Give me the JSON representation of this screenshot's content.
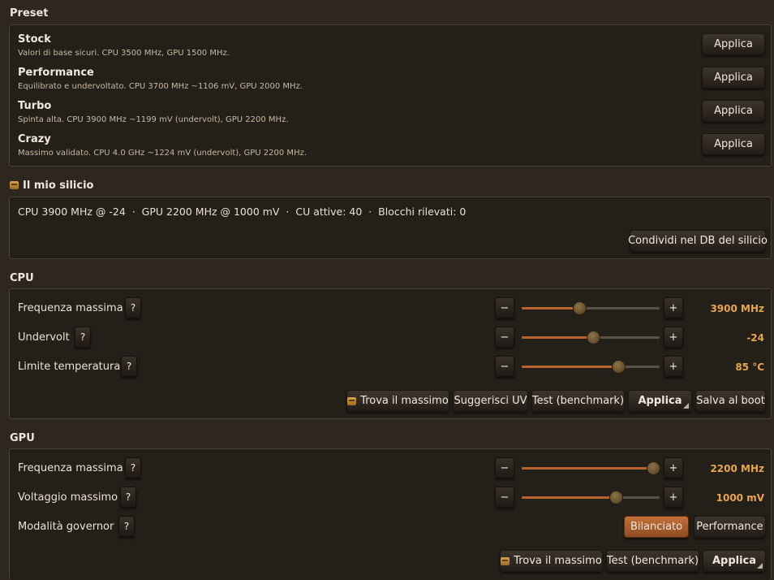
{
  "preset": {
    "title": "Preset",
    "items": [
      {
        "name": "Stock",
        "desc": "Valori di base sicuri. CPU 3500 MHz, GPU 1500 MHz.",
        "button": "Applica"
      },
      {
        "name": "Performance",
        "desc": "Equilibrato e undervoltato. CPU 3700 MHz ~1106 mV, GPU 2000 MHz.",
        "button": "Applica"
      },
      {
        "name": "Turbo",
        "desc": "Spinta alta. CPU 3900 MHz ~1199 mV (undervolt), GPU 2200 MHz.",
        "button": "Applica"
      },
      {
        "name": "Crazy",
        "desc": "Massimo validato. CPU 4.0 GHz ~1224 mV (undervolt), GPU 2200 MHz.",
        "button": "Applica"
      }
    ]
  },
  "silicon": {
    "title": "Il mio silicio",
    "summary": "CPU 3900 MHz @ -24  ·  GPU 2200 MHz @ 1000 mV  ·  CU attive: 40  ·  Blocchi rilevati: 0",
    "share_button": "Condividi nel DB del silicio"
  },
  "cpu": {
    "title": "CPU",
    "rows": [
      {
        "label": "Frequenza massima",
        "help": "?",
        "value": "3900 MHz",
        "level": 0.42
      },
      {
        "label": "Undervolt",
        "help": "?",
        "value": "-24",
        "level": 0.52
      },
      {
        "label": "Limite temperatura",
        "help": "?",
        "value": "85 °C",
        "level": 0.7
      }
    ],
    "minus": "−",
    "plus": "+",
    "actions": {
      "find_max": "Trova il massimo",
      "suggest_uv": "Suggerisci UV",
      "benchmark": "Test (benchmark)",
      "apply": "Applica",
      "save_boot": "Salva al boot"
    }
  },
  "gpu": {
    "title": "GPU",
    "rows": [
      {
        "label": "Frequenza massima",
        "help": "?",
        "value": "2200 MHz",
        "level": 0.95
      },
      {
        "label": "Voltaggio massimo",
        "help": "?",
        "value": "1000 mV",
        "level": 0.68
      }
    ],
    "governor": {
      "label": "Modalità governor",
      "help": "?",
      "options": [
        "Bilanciato",
        "Performance"
      ],
      "selected": "Bilanciato"
    },
    "minus": "−",
    "plus": "+",
    "actions": {
      "find_max": "Trova il massimo",
      "benchmark": "Test (benchmark)",
      "apply": "Applica"
    }
  },
  "colors": {
    "accent": "#b8622e",
    "value_text": "#e9a54c",
    "background": "#2d2720",
    "panel": "#231f19"
  },
  "icons": {
    "silicon_title": "chip-emoji-icon",
    "find_max": "chip-emoji-icon"
  }
}
